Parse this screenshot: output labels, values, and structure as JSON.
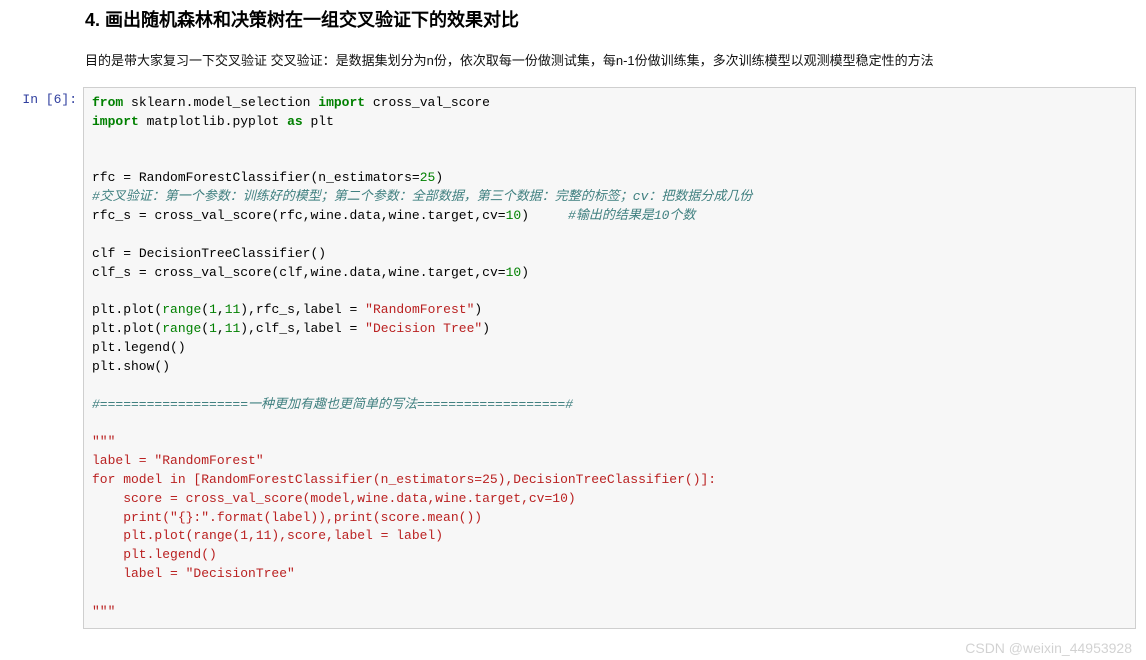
{
  "section": {
    "title": "4. 画出随机森林和决策树在一组交叉验证下的效果对比",
    "desc": "目的是带大家复习一下交叉验证 交叉验证：是数据集划分为n份，依次取每一份做测试集，每n-1份做训练集，多次训练模型以观测模型稳定性的方法"
  },
  "cell": {
    "prompt": "In  [6]:",
    "code": {
      "l1": {
        "kw1": "from",
        "mod": "sklearn.model_selection",
        "kw2": "import",
        "name": "cross_val_score"
      },
      "l2": {
        "kw1": "import",
        "mod": "matplotlib.pyplot",
        "kw2": "as",
        "alias": "plt"
      },
      "l3": "",
      "l4": "",
      "l5": {
        "var": "rfc",
        "eq": "=",
        "cls": "RandomForestClassifier",
        "lp": "(",
        "arg": "n_estimators",
        "asn": "=",
        "num": "25",
        "rp": ")"
      },
      "l6": {
        "comment": "#交叉验证：第一个参数：训练好的模型；第二个参数：全部数据，第三个数据：完整的标签；cv：把数据分成几份"
      },
      "l7": {
        "var": "rfc_s",
        "eq": "=",
        "fn": "cross_val_score",
        "lp": "(",
        "a1": "rfc,",
        "a2": "wine.data,",
        "a3": "wine.target,",
        "kw": "cv",
        "asn": "=",
        "num": "10",
        "rp": ")",
        "sp": "     ",
        "comment": "#输出的结果是10个数"
      },
      "l8": "",
      "l9": {
        "var": "clf",
        "eq": "=",
        "cls": "DecisionTreeClassifier",
        "lp": "(",
        "rp": ")"
      },
      "l10": {
        "var": "clf_s",
        "eq": "=",
        "fn": "cross_val_score",
        "lp": "(",
        "a1": "clf,",
        "a2": "wine.data,",
        "a3": "wine.target,",
        "kw": "cv",
        "asn": "=",
        "num": "10",
        "rp": ")"
      },
      "l11": "",
      "l12": {
        "obj": "plt.plot",
        "lp": "(",
        "fn": "range",
        "r1": "(",
        "n1": "1",
        "c": ",",
        "n2": "11",
        "r2": "),",
        "arr": "rfc_s,",
        "kw": "label",
        "eq": "=",
        "str": "\"RandomForest\"",
        "rp": ")"
      },
      "l13": {
        "obj": "plt.plot",
        "lp": "(",
        "fn": "range",
        "r1": "(",
        "n1": "1",
        "c": ",",
        "n2": "11",
        "r2": "),",
        "arr": "clf_s,",
        "kw": "label",
        "eq": "=",
        "str": "\"Decision Tree\"",
        "rp": ")"
      },
      "l14": "plt.legend()",
      "l15": "plt.show()",
      "l16": "",
      "l17": {
        "comment": "#===================一种更加有趣也更简单的写法===================#"
      },
      "l18": "",
      "l19": {
        "str": "\"\"\""
      },
      "l20": {
        "txt": "label = \"RandomForest\""
      },
      "l21": {
        "txt": "for model in [RandomForestClassifier(n_estimators=25),DecisionTreeClassifier()]:"
      },
      "l22": {
        "txt": "    score = cross_val_score(model,wine.data,wine.target,cv=10)"
      },
      "l23": {
        "txt": "    print(\"{}:\".format(label)),print(score.mean())"
      },
      "l24": {
        "txt": "    plt.plot(range(1,11),score,label = label)"
      },
      "l25": {
        "txt": "    plt.legend()"
      },
      "l26": {
        "txt": "    label = \"DecisionTree\""
      },
      "l27": "",
      "l28": {
        "str": "\"\"\""
      }
    }
  },
  "watermark": "CSDN @weixin_44953928"
}
